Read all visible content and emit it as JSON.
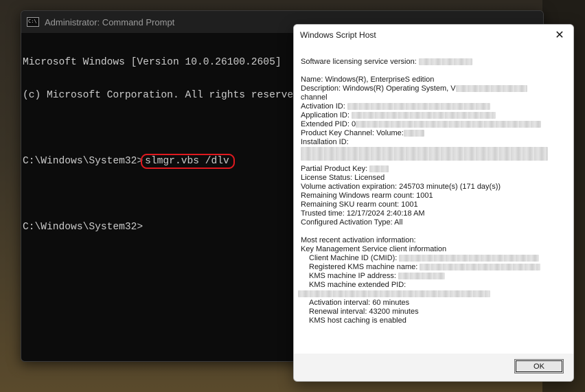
{
  "cmd": {
    "title": "Administrator: Command Prompt",
    "lines": [
      "Microsoft Windows [Version 10.0.26100.2605]",
      "(c) Microsoft Corporation. All rights reserved."
    ],
    "prompt": "C:\\Windows\\System32>",
    "command": "slmgr.vbs /dlv",
    "prompt2": "C:\\Windows\\System32>"
  },
  "dialog": {
    "title": "Windows Script Host",
    "close_icon": "close-icon",
    "lines": {
      "service_version": "Software licensing service version:",
      "name": "Name: Windows(R), EnterpriseS edition",
      "description": "Description: Windows(R) Operating System, V",
      "channel": "channel",
      "activation_id": "Activation ID:",
      "application_id": "Application ID:",
      "extended_pid": "Extended PID: 0",
      "product_key_channel": "Product Key Channel: Volume:",
      "installation_id": "Installation ID:",
      "partial_product_key": "Partial Product Key:",
      "license_status": "License Status: Licensed",
      "volume_expiration": "Volume activation expiration: 245703 minute(s) (171 day(s))",
      "rearm_windows": "Remaining Windows rearm count: 1001",
      "rearm_sku": "Remaining SKU rearm count: 1001",
      "trusted_time": "Trusted time: 12/17/2024 2:40:18 AM",
      "activation_type": "Configured Activation Type: All",
      "recent_info": "Most recent activation information:",
      "kms_client_info": "Key Management Service client information",
      "cmid": "Client Machine ID (CMID):",
      "kms_name": "Registered KMS machine name:",
      "kms_ip": "KMS machine IP address:",
      "kms_pid": "KMS machine extended PID:",
      "activation_interval": "Activation interval: 60 minutes",
      "renewal_interval": "Renewal interval: 43200 minutes",
      "kms_caching": "KMS host caching is enabled"
    },
    "ok_label": "OK"
  },
  "colors": {
    "highlight": "#e0191f",
    "console_bg": "#0c0c0c",
    "console_text": "#cccccc"
  }
}
